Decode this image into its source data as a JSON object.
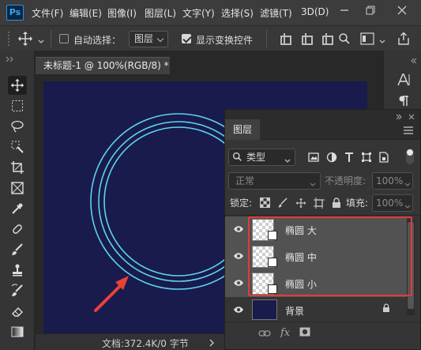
{
  "app": {
    "logo": "Ps"
  },
  "menu": [
    "文件(F)",
    "编辑(E)",
    "图像(I)",
    "图层(L)",
    "文字(Y)",
    "选择(S)",
    "滤镜(T)",
    "3D(D)"
  ],
  "window_controls": [
    "minimize-icon",
    "restore-icon",
    "close-icon"
  ],
  "options_bar": {
    "auto_select_label": "自动选择：",
    "auto_select_checked": false,
    "auto_select_target": "图层",
    "show_transform_label": "显示变换控件",
    "show_transform_checked": true
  },
  "document": {
    "tab_title": "未标题-1 @ 100%(RGB/8) *",
    "status": "文档:372.4K/0 字节",
    "canvas_color": "#181b4c",
    "ring_color": "#5fd3f0",
    "arrow_color": "#e8413a"
  },
  "layers_panel": {
    "title": "图层",
    "filter_kind": "类型",
    "blend_mode": "正常",
    "opacity_label": "不透明度:",
    "opacity_value": "100%",
    "lock_label": "锁定:",
    "fill_label": "填充:",
    "fill_value": "100%",
    "layers": [
      {
        "name": "椭圆 大",
        "visible": true,
        "selected": true
      },
      {
        "name": "椭圆 中",
        "visible": true,
        "selected": true
      },
      {
        "name": "椭圆 小",
        "visible": true,
        "selected": true
      },
      {
        "name": "背景",
        "visible": true,
        "locked": true
      }
    ],
    "highlight_color": "#e23b3b"
  }
}
